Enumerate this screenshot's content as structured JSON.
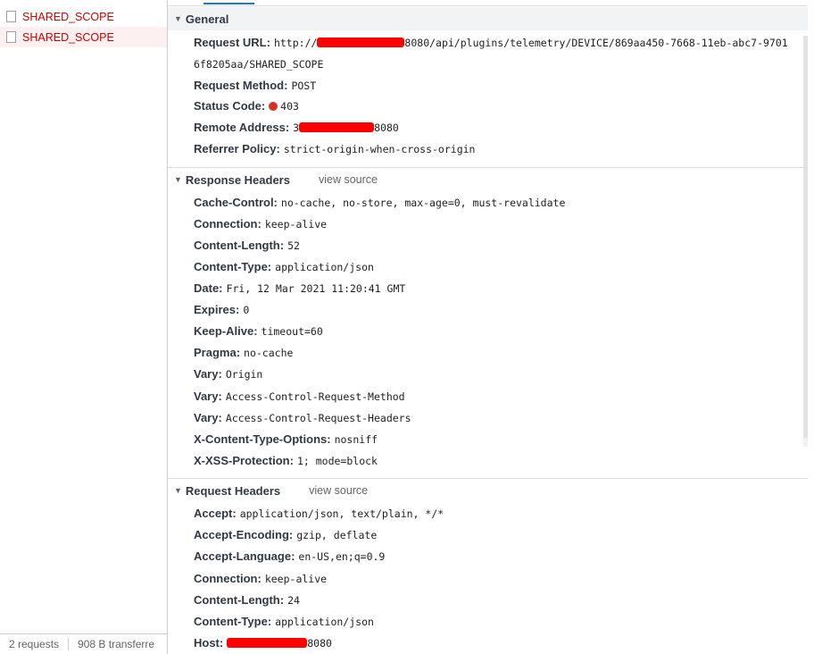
{
  "request_list": {
    "items": [
      {
        "name": "SHARED_SCOPE"
      },
      {
        "name": "SHARED_SCOPE"
      }
    ],
    "status": {
      "requests": "2 requests",
      "transferred": "908 B transferre"
    }
  },
  "general": {
    "title": "General",
    "fields": [
      {
        "key": "Request URL:",
        "value_prefix": "http://",
        "value_suffix": "8080/api/plugins/telemetry/DEVICE/869aa450-7668-11eb-abc7-9701",
        "value_cont": "6f8205aa/SHARED_SCOPE"
      },
      {
        "key": "Request Method:",
        "value": "POST"
      },
      {
        "key": "Status Code:",
        "value": "403"
      },
      {
        "key": "Remote Address:",
        "value_prefix": "3",
        "value_suffix": "8080"
      },
      {
        "key": "Referrer Policy:",
        "value": "strict-origin-when-cross-origin"
      }
    ]
  },
  "response_headers": {
    "title": "Response Headers",
    "view_source": "view source",
    "fields": [
      {
        "key": "Cache-Control:",
        "value": "no-cache, no-store, max-age=0, must-revalidate"
      },
      {
        "key": "Connection:",
        "value": "keep-alive"
      },
      {
        "key": "Content-Length:",
        "value": "52"
      },
      {
        "key": "Content-Type:",
        "value": "application/json"
      },
      {
        "key": "Date:",
        "value": "Fri, 12 Mar 2021 11:20:41 GMT"
      },
      {
        "key": "Expires:",
        "value": "0"
      },
      {
        "key": "Keep-Alive:",
        "value": "timeout=60"
      },
      {
        "key": "Pragma:",
        "value": "no-cache"
      },
      {
        "key": "Vary:",
        "value": "Origin"
      },
      {
        "key": "Vary:",
        "value": "Access-Control-Request-Method"
      },
      {
        "key": "Vary:",
        "value": "Access-Control-Request-Headers"
      },
      {
        "key": "X-Content-Type-Options:",
        "value": "nosniff"
      },
      {
        "key": "X-XSS-Protection:",
        "value": "1; mode=block"
      }
    ]
  },
  "request_headers": {
    "title": "Request Headers",
    "view_source": "view source",
    "fields": [
      {
        "key": "Accept:",
        "value": "application/json, text/plain, */*"
      },
      {
        "key": "Accept-Encoding:",
        "value": "gzip, deflate"
      },
      {
        "key": "Accept-Language:",
        "value": "en-US,en;q=0.9"
      },
      {
        "key": "Connection:",
        "value": "keep-alive"
      },
      {
        "key": "Content-Length:",
        "value": "24"
      },
      {
        "key": "Content-Type:",
        "value": "application/json"
      },
      {
        "key": "Host:",
        "value_suffix": "8080"
      }
    ]
  },
  "colors": {
    "error_text": "#c80000",
    "status_dot": "#d93025",
    "redaction": "#ff0000",
    "tab_accent": "#1a73e8"
  },
  "icons": {
    "collapse": "triangle-down-icon",
    "status": "red-dot-icon",
    "checkbox": "checkbox-icon"
  }
}
